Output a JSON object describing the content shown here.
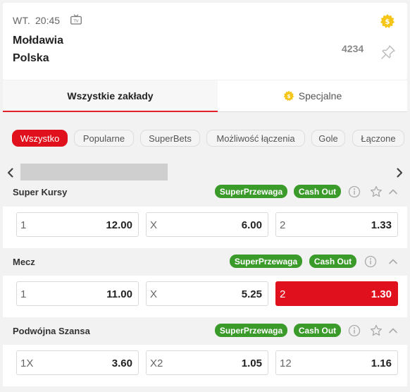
{
  "event": {
    "day": "WT.",
    "time": "20:45",
    "team_home": "Mołdawia",
    "team_away": "Polska",
    "markets_count": "4234",
    "icons": [
      "tv-icon",
      "coin-icon",
      "pin-icon"
    ]
  },
  "tabs": [
    {
      "label": "Wszystkie zakłady",
      "active": true
    },
    {
      "label": "Specjalne",
      "active": false,
      "icon": "coin-icon"
    }
  ],
  "filters": [
    "Wszystko",
    "Popularne",
    "SuperBets",
    "Możliwość łączenia",
    "Gole",
    "Łączone"
  ],
  "active_filter": "Wszystko",
  "sections": [
    {
      "title": "Super Kursy",
      "badges": [
        "SuperPrzewaga",
        "Cash Out"
      ],
      "odds": [
        {
          "label": "1",
          "value": "12.00"
        },
        {
          "label": "X",
          "value": "6.00"
        },
        {
          "label": "2",
          "value": "1.33"
        }
      ]
    },
    {
      "title": "Mecz",
      "badges": [
        "SuperPrzewaga",
        "Cash Out"
      ],
      "odds": [
        {
          "label": "1",
          "value": "11.00"
        },
        {
          "label": "X",
          "value": "5.25"
        },
        {
          "label": "2",
          "value": "1.30",
          "selected": true
        }
      ]
    },
    {
      "title": "Podwójna Szansa",
      "badges": [
        "SuperPrzewaga",
        "Cash Out"
      ],
      "odds": [
        {
          "label": "1X",
          "value": "3.60"
        },
        {
          "label": "X2",
          "value": "1.05"
        },
        {
          "label": "12",
          "value": "1.16"
        }
      ]
    }
  ],
  "colors": {
    "brand_red": "#e0111c",
    "badge_green": "#3a9a2a",
    "coin_gold": "#f5c518"
  }
}
